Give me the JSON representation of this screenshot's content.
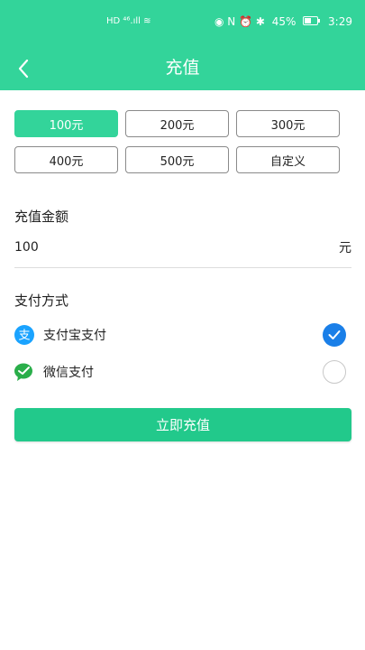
{
  "status_bar": {
    "left_indicators": "HD ⁴⁶.ıll ≋",
    "right_indicators": "◉ N ⏰ ✱",
    "battery": "45%",
    "time": "3:29"
  },
  "header": {
    "title": "充值",
    "back_icon": "chevron-left-icon"
  },
  "amount_options": [
    {
      "label": "100元",
      "selected": true
    },
    {
      "label": "200元",
      "selected": false
    },
    {
      "label": "300元",
      "selected": false
    },
    {
      "label": "400元",
      "selected": false
    },
    {
      "label": "500元",
      "selected": false
    },
    {
      "label": "自定义",
      "selected": false
    }
  ],
  "amount_section": {
    "label": "充值金额",
    "value": "100",
    "unit": "元"
  },
  "payment_section": {
    "label": "支付方式",
    "methods": [
      {
        "label": "支付宝支付",
        "icon": "alipay-icon",
        "selected": true
      },
      {
        "label": "微信支付",
        "icon": "wechat-icon",
        "selected": false
      }
    ]
  },
  "submit_label": "立即充值",
  "colors": {
    "primary": "#33d49a",
    "button": "#22c98b",
    "radio_selected": "#1a7fe8",
    "alipay": "#1aa3ff",
    "wechat": "#2aae4a"
  }
}
